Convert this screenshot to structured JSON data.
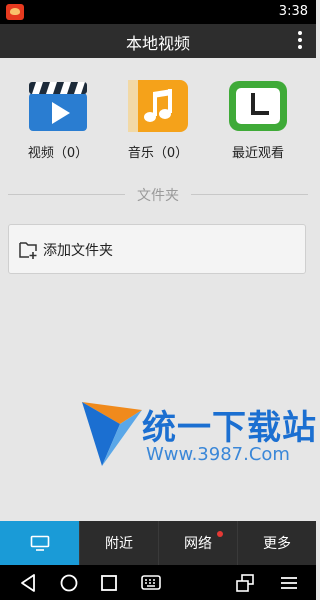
{
  "status_bar": {
    "time": "3:38"
  },
  "header": {
    "title": "本地视频"
  },
  "categories": [
    {
      "label": "视频（0）",
      "icon": "video-clapper-icon",
      "color": "#2a7dd1"
    },
    {
      "label": "音乐（0）",
      "icon": "music-note-icon",
      "color": "#f5a21a"
    },
    {
      "label": "最近观看",
      "icon": "clock-icon",
      "color": "#3faa38"
    }
  ],
  "folder_section": {
    "title": "文件夹",
    "add_label": "添加文件夹"
  },
  "watermark": {
    "text_cn": "统一下载站",
    "text_url": "Www.3987.Com"
  },
  "bottom_tabs": [
    {
      "label": "",
      "icon": "tv-icon",
      "active": true
    },
    {
      "label": "附近",
      "active": false
    },
    {
      "label": "网络",
      "active": false,
      "badge": true
    },
    {
      "label": "更多",
      "active": false
    }
  ],
  "colors": {
    "active_tab": "#1a9bd7",
    "tab_bar": "#2c2c2c",
    "app_bar": "#2d2d2d",
    "badge": "#e53935"
  }
}
